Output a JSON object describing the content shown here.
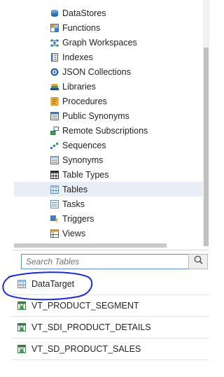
{
  "tree": {
    "items": [
      {
        "label": "DataStores",
        "icon": "datastores-icon"
      },
      {
        "label": "Functions",
        "icon": "functions-icon"
      },
      {
        "label": "Graph Workspaces",
        "icon": "graph-workspaces-icon"
      },
      {
        "label": "Indexes",
        "icon": "indexes-icon"
      },
      {
        "label": "JSON Collections",
        "icon": "json-collections-icon"
      },
      {
        "label": "Libraries",
        "icon": "libraries-icon"
      },
      {
        "label": "Procedures",
        "icon": "procedures-icon"
      },
      {
        "label": "Public Synonyms",
        "icon": "public-synonyms-icon"
      },
      {
        "label": "Remote Subscriptions",
        "icon": "remote-subscriptions-icon"
      },
      {
        "label": "Sequences",
        "icon": "sequences-icon"
      },
      {
        "label": "Synonyms",
        "icon": "synonyms-icon"
      },
      {
        "label": "Table Types",
        "icon": "table-types-icon"
      },
      {
        "label": "Tables",
        "icon": "tables-icon",
        "selected": true
      },
      {
        "label": "Tasks",
        "icon": "tasks-icon"
      },
      {
        "label": "Triggers",
        "icon": "triggers-icon"
      },
      {
        "label": "Views",
        "icon": "views-icon"
      }
    ]
  },
  "search": {
    "placeholder": "Search Tables",
    "value": ""
  },
  "results": [
    {
      "label": "DataTarget",
      "icon": "table-icon"
    },
    {
      "label": "VT_PRODUCT_SEGMENT",
      "icon": "virtual-table-icon"
    },
    {
      "label": "VT_SDI_PRODUCT_DETAILS",
      "icon": "virtual-table-icon"
    },
    {
      "label": "VT_SD_PRODUCT_SALES",
      "icon": "virtual-table-icon"
    }
  ],
  "colors": {
    "selection": "#e8eef5",
    "annotation": "#1a2bd6",
    "search_border": "#5b8cc4"
  }
}
